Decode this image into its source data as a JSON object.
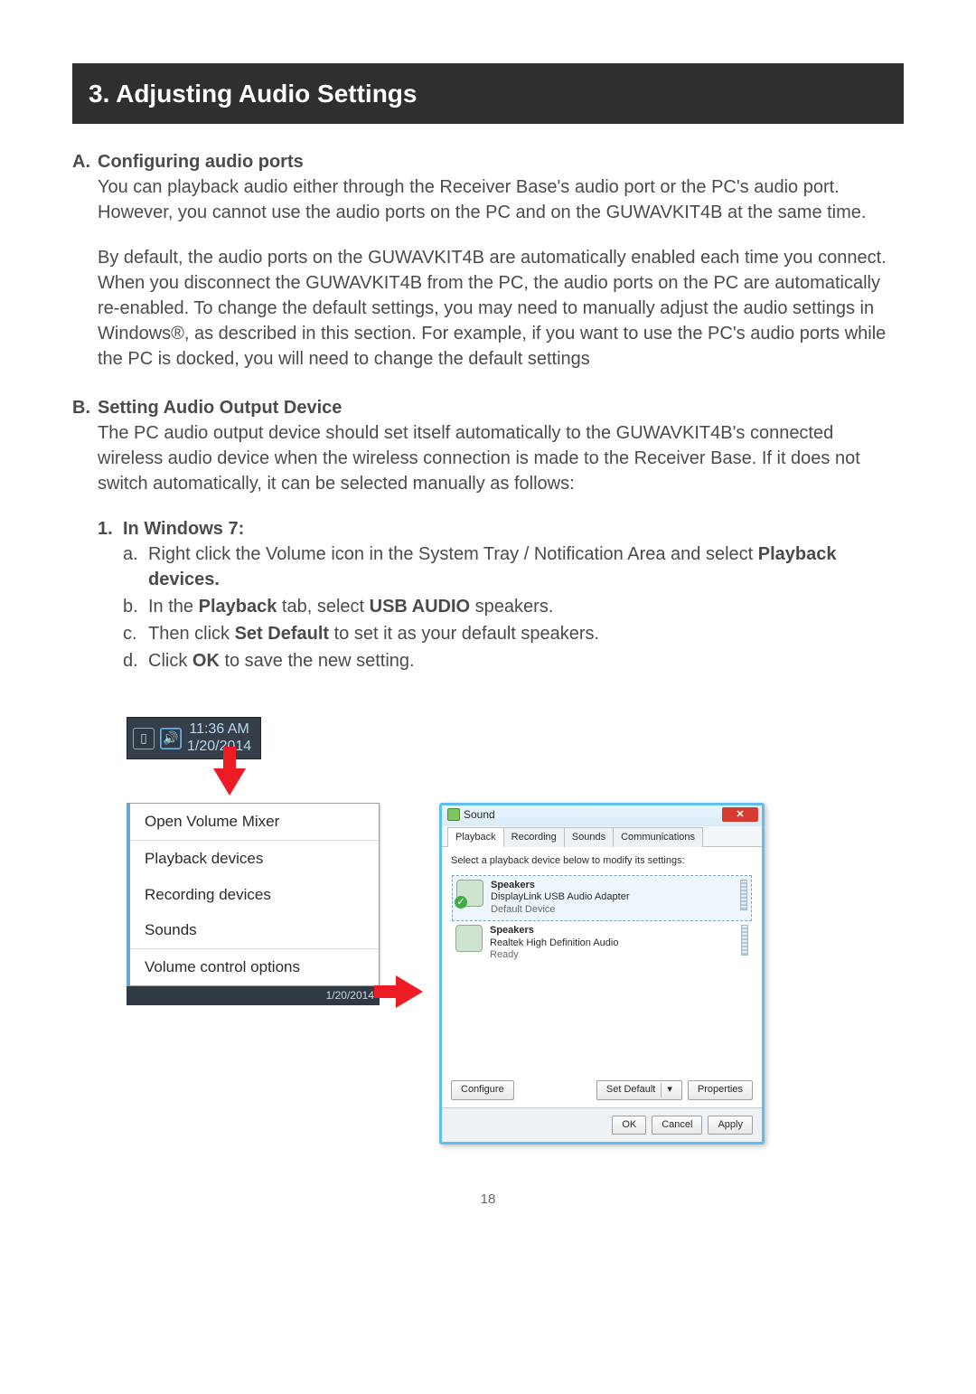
{
  "section_header": "3. Adjusting Audio Settings",
  "subA": {
    "label": "A.",
    "title": "Configuring audio ports",
    "p1": "You can playback audio either through the Receiver Base's audio port or the PC's audio port. However, you cannot use the audio ports on the PC and on the GUWAVKIT4B at the same time.",
    "p2": "By default, the audio ports on the GUWAVKIT4B are automatically enabled each time you connect. When you disconnect the GUWAVKIT4B from the PC, the audio ports on the PC are automatically re-enabled. To change the default settings, you may need to manually adjust the audio settings in Windows®, as described in this section. For example, if you want to use the PC's audio ports while the PC is docked, you will need to change the default settings"
  },
  "subB": {
    "label": "B.",
    "title": "Setting Audio Output Device",
    "p1": "The PC audio output device should set itself automatically to the GUWAVKIT4B's connected wireless audio device when the wireless connection is made to the Receiver Base. If it does not switch automatically, it can be selected manually as follows:",
    "step1_label": "1.",
    "step1_title": "In Windows 7:",
    "a_label": "a.",
    "a_pre": "Right click the Volume icon in the System Tray / Notification Area and select ",
    "a_bold": "Playback devices.",
    "b_label": "b.",
    "b_pre": "In the ",
    "b_bold1": "Playback",
    "b_mid": " tab, select ",
    "b_bold2": "USB AUDIO",
    "b_post": " speakers.",
    "c_label": "c.",
    "c_pre": "Then click ",
    "c_bold": "Set Default",
    "c_post": " to set it as your default speakers.",
    "d_label": "d.",
    "d_pre": "Click ",
    "d_bold": "OK",
    "d_post": " to save the new setting."
  },
  "tray": {
    "time": "11:36 AM",
    "date": "1/20/2014"
  },
  "context_menu": {
    "items": [
      "Open Volume Mixer",
      "Playback devices",
      "Recording devices",
      "Sounds",
      "Volume control options"
    ],
    "taskbar_date": "1/20/2014"
  },
  "sound_dialog": {
    "title": "Sound",
    "tabs": [
      "Playback",
      "Recording",
      "Sounds",
      "Communications"
    ],
    "hint": "Select a playback device below to modify its settings:",
    "devices": [
      {
        "name": "Speakers",
        "desc": "DisplayLink USB Audio Adapter",
        "status": "Default Device",
        "default": true
      },
      {
        "name": "Speakers",
        "desc": "Realtek High Definition Audio",
        "status": "Ready",
        "default": false
      }
    ],
    "buttons": {
      "configure": "Configure",
      "set_default": "Set Default",
      "properties": "Properties",
      "ok": "OK",
      "cancel": "Cancel",
      "apply": "Apply"
    }
  },
  "page_number": "18"
}
